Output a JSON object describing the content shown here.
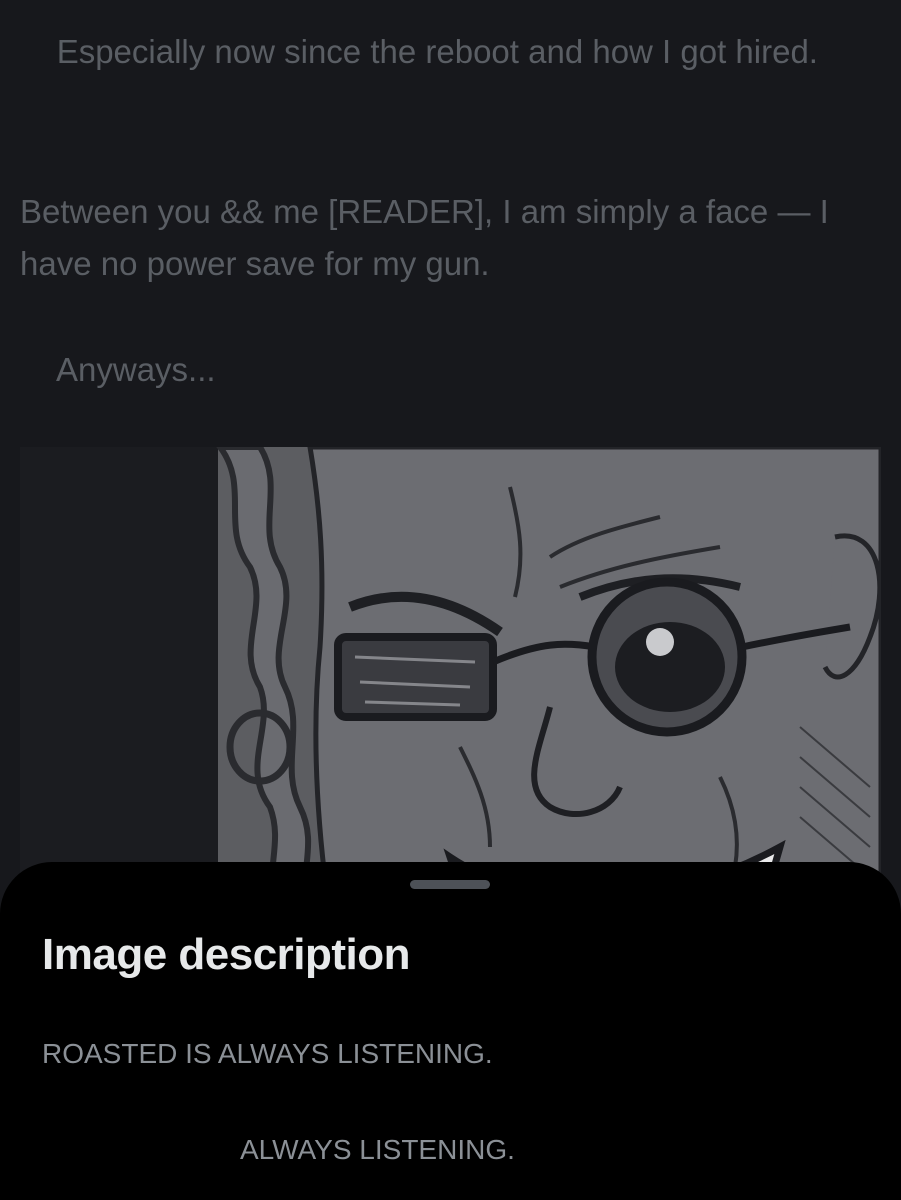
{
  "post": {
    "paragraph_1": "    Especially now since the reboot and how I got hired.",
    "paragraph_2": "Between you && me [READER], I am simply a face — I have no power save for my gun.",
    "paragraph_3": "Anyways..."
  },
  "media": {
    "kind": "manga-panel",
    "subject": "grinning bald man with round glasses"
  },
  "sheet": {
    "title": "Image description",
    "lines": [
      "ROASTED IS ALWAYS LISTENING.",
      "ALWAYS LISTENING."
    ]
  },
  "colors": {
    "background": "#17181c",
    "sheet": "#000000",
    "title": "#e7e9ea",
    "muted_text": "#5a5e64"
  }
}
